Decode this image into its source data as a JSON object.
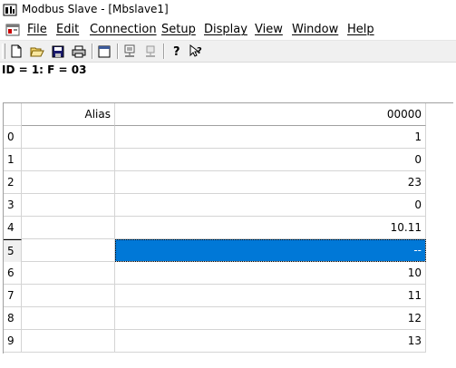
{
  "window": {
    "title": "Modbus Slave - [Mbslave1]"
  },
  "menubar": {
    "items": [
      {
        "label": "File"
      },
      {
        "label": "Edit"
      },
      {
        "label": "Connection"
      },
      {
        "label": "Setup"
      },
      {
        "label": "Display"
      },
      {
        "label": "View"
      },
      {
        "label": "Window"
      },
      {
        "label": "Help"
      }
    ]
  },
  "toolbar": {
    "buttons": [
      {
        "icon": "new-document-icon"
      },
      {
        "icon": "open-folder-icon"
      },
      {
        "icon": "save-icon"
      },
      {
        "icon": "print-icon"
      },
      {
        "icon": "window-icon"
      },
      {
        "icon": "connect-icon"
      },
      {
        "icon": "disconnect-icon"
      },
      {
        "icon": "help-icon"
      },
      {
        "icon": "context-help-icon"
      }
    ]
  },
  "status": {
    "text": "ID = 1: F = 03"
  },
  "grid": {
    "columns": {
      "alias": "Alias",
      "value": "00000"
    },
    "rows": [
      {
        "index": "0",
        "alias": "",
        "value": "1"
      },
      {
        "index": "1",
        "alias": "",
        "value": "0"
      },
      {
        "index": "2",
        "alias": "",
        "value": "23"
      },
      {
        "index": "3",
        "alias": "",
        "value": "0"
      },
      {
        "index": "4",
        "alias": "",
        "value": "10.11"
      },
      {
        "index": "5",
        "alias": "",
        "value": "--"
      },
      {
        "index": "6",
        "alias": "",
        "value": "10"
      },
      {
        "index": "7",
        "alias": "",
        "value": "11"
      },
      {
        "index": "8",
        "alias": "",
        "value": "12"
      },
      {
        "index": "9",
        "alias": "",
        "value": "13"
      }
    ],
    "selected_row": 5,
    "selection_color": "#0078d7"
  }
}
